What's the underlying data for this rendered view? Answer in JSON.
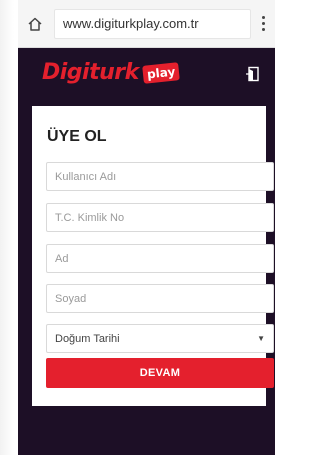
{
  "browser": {
    "url": "www.digiturkplay.com.tr"
  },
  "header": {
    "logo_text": "Digiturk",
    "logo_badge": "play"
  },
  "form": {
    "title": "ÜYE OL",
    "fields": [
      {
        "placeholder": "Kullanıcı Adı"
      },
      {
        "placeholder": "T.C. Kimlik No"
      },
      {
        "placeholder": "Ad"
      },
      {
        "placeholder": "Soyad"
      }
    ],
    "birthdate_select": "Doğum Tarihi",
    "submit_label": "DEVAM"
  },
  "colors": {
    "brand_red": "#e4202d",
    "site_background": "#1d0f26"
  }
}
